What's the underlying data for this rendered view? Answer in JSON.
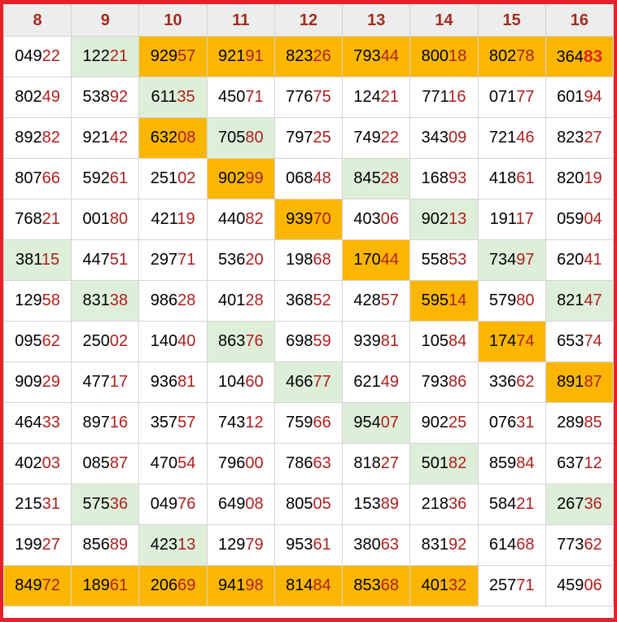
{
  "headers": [
    "8",
    "9",
    "10",
    "11",
    "12",
    "13",
    "14",
    "15",
    "16"
  ],
  "rows": [
    [
      {
        "p": "049",
        "s": "22",
        "bg": ""
      },
      {
        "p": "122",
        "s": "21",
        "bg": "g"
      },
      {
        "p": "929",
        "s": "57",
        "bg": "o"
      },
      {
        "p": "921",
        "s": "91",
        "bg": "o"
      },
      {
        "p": "823",
        "s": "26",
        "bg": "o"
      },
      {
        "p": "793",
        "s": "44",
        "bg": "o"
      },
      {
        "p": "800",
        "s": "18",
        "bg": "o"
      },
      {
        "p": "802",
        "s": "78",
        "bg": "o"
      },
      {
        "p": "364",
        "s": "83",
        "bg": "o",
        "bold": true
      }
    ],
    [
      {
        "p": "802",
        "s": "49",
        "bg": ""
      },
      {
        "p": "538",
        "s": "92",
        "bg": ""
      },
      {
        "p": "611",
        "s": "35",
        "bg": "g"
      },
      {
        "p": "450",
        "s": "71",
        "bg": ""
      },
      {
        "p": "776",
        "s": "75",
        "bg": ""
      },
      {
        "p": "124",
        "s": "21",
        "bg": ""
      },
      {
        "p": "771",
        "s": "16",
        "bg": ""
      },
      {
        "p": "071",
        "s": "77",
        "bg": ""
      },
      {
        "p": "601",
        "s": "94",
        "bg": ""
      }
    ],
    [
      {
        "p": "892",
        "s": "82",
        "bg": ""
      },
      {
        "p": "921",
        "s": "42",
        "bg": ""
      },
      {
        "p": "632",
        "s": "08",
        "bg": "o"
      },
      {
        "p": "705",
        "s": "80",
        "bg": "g"
      },
      {
        "p": "797",
        "s": "25",
        "bg": ""
      },
      {
        "p": "749",
        "s": "22",
        "bg": ""
      },
      {
        "p": "343",
        "s": "09",
        "bg": ""
      },
      {
        "p": "721",
        "s": "46",
        "bg": ""
      },
      {
        "p": "823",
        "s": "27",
        "bg": ""
      }
    ],
    [
      {
        "p": "807",
        "s": "66",
        "bg": ""
      },
      {
        "p": "592",
        "s": "61",
        "bg": ""
      },
      {
        "p": "251",
        "s": "02",
        "bg": ""
      },
      {
        "p": "902",
        "s": "99",
        "bg": "o"
      },
      {
        "p": "068",
        "s": "48",
        "bg": ""
      },
      {
        "p": "845",
        "s": "28",
        "bg": "g"
      },
      {
        "p": "168",
        "s": "93",
        "bg": ""
      },
      {
        "p": "418",
        "s": "61",
        "bg": ""
      },
      {
        "p": "820",
        "s": "19",
        "bg": ""
      }
    ],
    [
      {
        "p": "768",
        "s": "21",
        "bg": ""
      },
      {
        "p": "001",
        "s": "80",
        "bg": ""
      },
      {
        "p": "421",
        "s": "19",
        "bg": ""
      },
      {
        "p": "440",
        "s": "82",
        "bg": ""
      },
      {
        "p": "939",
        "s": "70",
        "bg": "o"
      },
      {
        "p": "403",
        "s": "06",
        "bg": ""
      },
      {
        "p": "902",
        "s": "13",
        "bg": "g"
      },
      {
        "p": "191",
        "s": "17",
        "bg": ""
      },
      {
        "p": "059",
        "s": "04",
        "bg": ""
      }
    ],
    [
      {
        "p": "381",
        "s": "15",
        "bg": "g"
      },
      {
        "p": "447",
        "s": "51",
        "bg": ""
      },
      {
        "p": "297",
        "s": "71",
        "bg": ""
      },
      {
        "p": "536",
        "s": "20",
        "bg": ""
      },
      {
        "p": "198",
        "s": "68",
        "bg": ""
      },
      {
        "p": "170",
        "s": "44",
        "bg": "o"
      },
      {
        "p": "558",
        "s": "53",
        "bg": ""
      },
      {
        "p": "734",
        "s": "97",
        "bg": "g"
      },
      {
        "p": "620",
        "s": "41",
        "bg": ""
      }
    ],
    [
      {
        "p": "129",
        "s": "58",
        "bg": ""
      },
      {
        "p": "831",
        "s": "38",
        "bg": "g"
      },
      {
        "p": "986",
        "s": "28",
        "bg": ""
      },
      {
        "p": "401",
        "s": "28",
        "bg": ""
      },
      {
        "p": "368",
        "s": "52",
        "bg": ""
      },
      {
        "p": "428",
        "s": "57",
        "bg": ""
      },
      {
        "p": "595",
        "s": "14",
        "bg": "o"
      },
      {
        "p": "579",
        "s": "80",
        "bg": ""
      },
      {
        "p": "821",
        "s": "47",
        "bg": "g"
      }
    ],
    [
      {
        "p": "095",
        "s": "62",
        "bg": ""
      },
      {
        "p": "250",
        "s": "02",
        "bg": ""
      },
      {
        "p": "140",
        "s": "40",
        "bg": ""
      },
      {
        "p": "863",
        "s": "76",
        "bg": "g"
      },
      {
        "p": "698",
        "s": "59",
        "bg": ""
      },
      {
        "p": "939",
        "s": "81",
        "bg": ""
      },
      {
        "p": "105",
        "s": "84",
        "bg": ""
      },
      {
        "p": "174",
        "s": "74",
        "bg": "o"
      },
      {
        "p": "653",
        "s": "74",
        "bg": ""
      }
    ],
    [
      {
        "p": "909",
        "s": "29",
        "bg": ""
      },
      {
        "p": "477",
        "s": "17",
        "bg": ""
      },
      {
        "p": "936",
        "s": "81",
        "bg": ""
      },
      {
        "p": "104",
        "s": "60",
        "bg": ""
      },
      {
        "p": "466",
        "s": "77",
        "bg": "g"
      },
      {
        "p": "621",
        "s": "49",
        "bg": ""
      },
      {
        "p": "793",
        "s": "86",
        "bg": ""
      },
      {
        "p": "336",
        "s": "62",
        "bg": ""
      },
      {
        "p": "891",
        "s": "87",
        "bg": "o"
      }
    ],
    [
      {
        "p": "464",
        "s": "33",
        "bg": ""
      },
      {
        "p": "897",
        "s": "16",
        "bg": ""
      },
      {
        "p": "357",
        "s": "57",
        "bg": ""
      },
      {
        "p": "743",
        "s": "12",
        "bg": ""
      },
      {
        "p": "759",
        "s": "66",
        "bg": ""
      },
      {
        "p": "954",
        "s": "07",
        "bg": "g"
      },
      {
        "p": "902",
        "s": "25",
        "bg": ""
      },
      {
        "p": "076",
        "s": "31",
        "bg": ""
      },
      {
        "p": "289",
        "s": "85",
        "bg": ""
      }
    ],
    [
      {
        "p": "402",
        "s": "03",
        "bg": ""
      },
      {
        "p": "085",
        "s": "87",
        "bg": ""
      },
      {
        "p": "470",
        "s": "54",
        "bg": ""
      },
      {
        "p": "796",
        "s": "00",
        "bg": ""
      },
      {
        "p": "786",
        "s": "63",
        "bg": ""
      },
      {
        "p": "818",
        "s": "27",
        "bg": ""
      },
      {
        "p": "501",
        "s": "82",
        "bg": "g"
      },
      {
        "p": "859",
        "s": "84",
        "bg": ""
      },
      {
        "p": "637",
        "s": "12",
        "bg": ""
      }
    ],
    [
      {
        "p": "215",
        "s": "31",
        "bg": ""
      },
      {
        "p": "575",
        "s": "36",
        "bg": "g"
      },
      {
        "p": "049",
        "s": "76",
        "bg": ""
      },
      {
        "p": "649",
        "s": "08",
        "bg": ""
      },
      {
        "p": "805",
        "s": "05",
        "bg": ""
      },
      {
        "p": "153",
        "s": "89",
        "bg": ""
      },
      {
        "p": "218",
        "s": "36",
        "bg": ""
      },
      {
        "p": "584",
        "s": "21",
        "bg": ""
      },
      {
        "p": "267",
        "s": "36",
        "bg": "g"
      }
    ],
    [
      {
        "p": "199",
        "s": "27",
        "bg": ""
      },
      {
        "p": "856",
        "s": "89",
        "bg": ""
      },
      {
        "p": "423",
        "s": "13",
        "bg": "g"
      },
      {
        "p": "129",
        "s": "79",
        "bg": ""
      },
      {
        "p": "953",
        "s": "61",
        "bg": ""
      },
      {
        "p": "380",
        "s": "63",
        "bg": ""
      },
      {
        "p": "831",
        "s": "92",
        "bg": ""
      },
      {
        "p": "614",
        "s": "68",
        "bg": ""
      },
      {
        "p": "773",
        "s": "62",
        "bg": ""
      }
    ],
    [
      {
        "p": "849",
        "s": "72",
        "bg": "o"
      },
      {
        "p": "189",
        "s": "61",
        "bg": "o"
      },
      {
        "p": "206",
        "s": "69",
        "bg": "o"
      },
      {
        "p": "941",
        "s": "98",
        "bg": "o"
      },
      {
        "p": "814",
        "s": "84",
        "bg": "o"
      },
      {
        "p": "853",
        "s": "68",
        "bg": "o"
      },
      {
        "p": "401",
        "s": "32",
        "bg": "o"
      },
      {
        "p": "257",
        "s": "71",
        "bg": ""
      },
      {
        "p": "459",
        "s": "06",
        "bg": ""
      }
    ]
  ],
  "colors": {
    "frame": "#e3212b",
    "header_bg": "#ededed",
    "header_text": "#a32d1e",
    "highlight_green": "#deefd9",
    "highlight_orange": "#fbb700",
    "suffix_text": "#b01e1e"
  }
}
